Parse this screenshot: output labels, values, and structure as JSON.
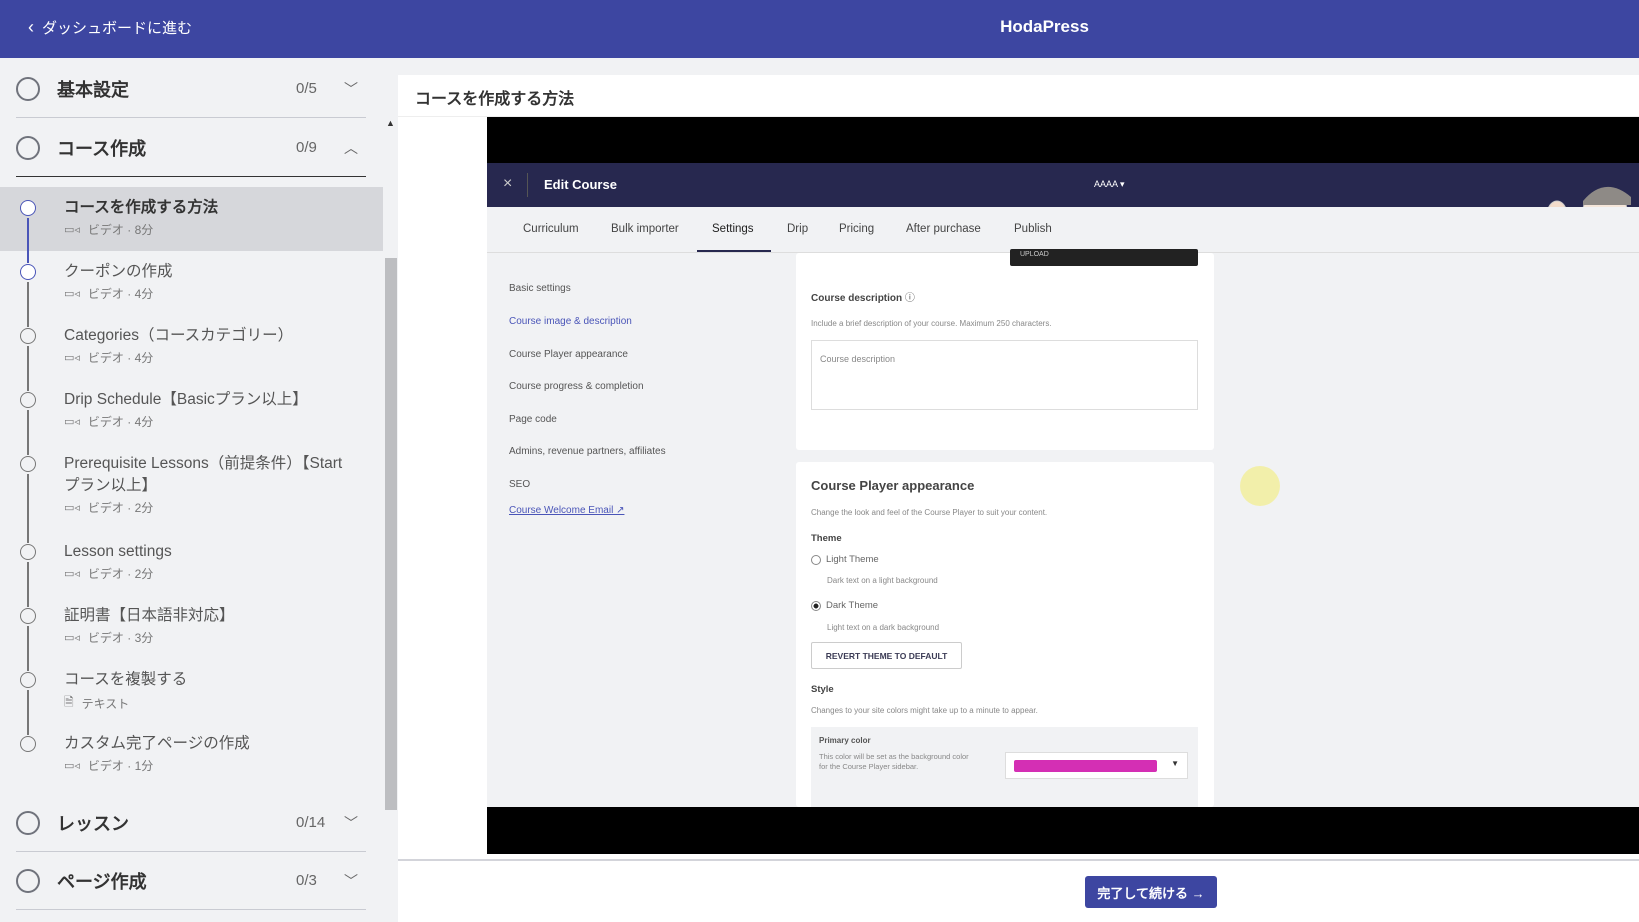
{
  "header": {
    "back_label": "ダッシュボードに進む",
    "brand": "HodaPress"
  },
  "sidebar": {
    "sections": [
      {
        "title": "基本設定",
        "count": "0/5"
      },
      {
        "title": "コース作成",
        "count": "0/9"
      },
      {
        "title": "レッスン",
        "count": "0/14"
      },
      {
        "title": "ページ作成",
        "count": "0/3"
      }
    ],
    "lessons": [
      {
        "title": "コースを作成する方法",
        "meta": "ビデオ · 8分"
      },
      {
        "title": "クーポンの作成",
        "meta": "ビデオ · 4分"
      },
      {
        "title": "Categories（コースカテゴリー）",
        "meta": "ビデオ · 4分"
      },
      {
        "title": "Drip Schedule【Basicプラン以上】",
        "meta": "ビデオ · 4分"
      },
      {
        "title": "Prerequisite Lessons（前提条件）【Startプラン以上】",
        "meta": "ビデオ · 2分"
      },
      {
        "title": "Lesson settings",
        "meta": "ビデオ · 2分"
      },
      {
        "title": "証明書【日本語非対応】",
        "meta": "ビデオ · 3分"
      },
      {
        "title": "コースを複製する",
        "meta": "テキスト"
      },
      {
        "title": "カスタム完了ページの作成",
        "meta": "ビデオ · 1分"
      }
    ]
  },
  "main": {
    "title": "コースを作成する方法",
    "done_button": "完了して続ける →"
  },
  "video": {
    "close": "×",
    "title": "Edit Course",
    "account": "AAAA ▾",
    "tabs": [
      "Curriculum",
      "Bulk importer",
      "Settings",
      "Drip",
      "Pricing",
      "After purchase",
      "Publish"
    ],
    "nav": [
      "Basic settings",
      "Course image & description",
      "Course Player appearance",
      "Course progress & completion",
      "Page code",
      "Admins, revenue partners, affiliates",
      "SEO",
      "Course Welcome Email ↗"
    ],
    "upload": "UPLOAD",
    "desc_label": "Course description",
    "desc_help": "Include a brief description of your course. Maximum 250 characters.",
    "desc_placeholder": "Course description",
    "appearance_title": "Course Player appearance",
    "appearance_help": "Change the look and feel of the Course Player to suit your content.",
    "theme_label": "Theme",
    "light": "Light Theme",
    "light_help": "Dark text on a light background",
    "dark": "Dark Theme",
    "dark_help": "Light text on a dark background",
    "revert": "REVERT THEME TO DEFAULT",
    "style_label": "Style",
    "style_help": "Changes to your site colors might take up to a minute to appear.",
    "primary_label": "Primary color",
    "primary_help": "This color will be set as the background color for the Course Player sidebar.",
    "primary_color": "#d42fb4"
  }
}
